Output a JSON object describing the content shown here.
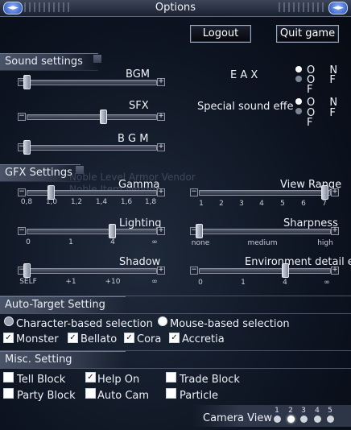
{
  "window": {
    "title": "Options"
  },
  "top_buttons": {
    "logout": "Logout",
    "quit": "Quit game"
  },
  "sound": {
    "header": "Sound settings",
    "bgm_label": "BGM",
    "sfx_label": "SFX",
    "bgm2_label": "B  G  M",
    "eax_label": "E  A  X",
    "special_label": "Special sound effe",
    "on": "O  N",
    "off": "O F F"
  },
  "gfx": {
    "header": "GFX Settings",
    "gamma_label": "Gamma",
    "gamma_ticks": [
      "0,8",
      "1,0",
      "1,2",
      "1,4",
      "1,6",
      "1,8"
    ],
    "view_label": "View Range",
    "view_ticks": [
      "1",
      "2",
      "3",
      "4",
      "5",
      "6",
      "7"
    ],
    "lighting_label": "Lighting",
    "lighting_ticks": [
      "0",
      "1",
      "4",
      "∞"
    ],
    "sharpness_label": "Sharpness",
    "sharpness_ticks": [
      "none",
      "medium",
      "high"
    ],
    "shadow_label": "Shadow",
    "shadow_ticks": [
      "SELF",
      "+1",
      "+10",
      "∞"
    ],
    "env_label": "Environment detail e",
    "env_ticks": [
      "0",
      "1",
      "4",
      "∞"
    ]
  },
  "autotarget": {
    "header": "Auto-Target Setting",
    "char_sel": "Character-based selection",
    "mouse_sel": "Mouse-based selection",
    "monster": "Monster",
    "bellato": "Bellato",
    "cora": "Cora",
    "accretia": "Accretia"
  },
  "misc": {
    "header": "Misc. Setting",
    "tell_block": "Tell Block",
    "help_on": "Help On",
    "trade_block": "Trade Block",
    "party_block": "Party Block",
    "auto_cam": "Auto Cam",
    "particle": "Particle",
    "camera_view": "Camera View",
    "camera_nums": [
      "1",
      "2",
      "3",
      "4",
      "5"
    ]
  },
  "background_ghost": [
    "Noble Level Armor Vendor",
    "Noble Item Vendor"
  ]
}
